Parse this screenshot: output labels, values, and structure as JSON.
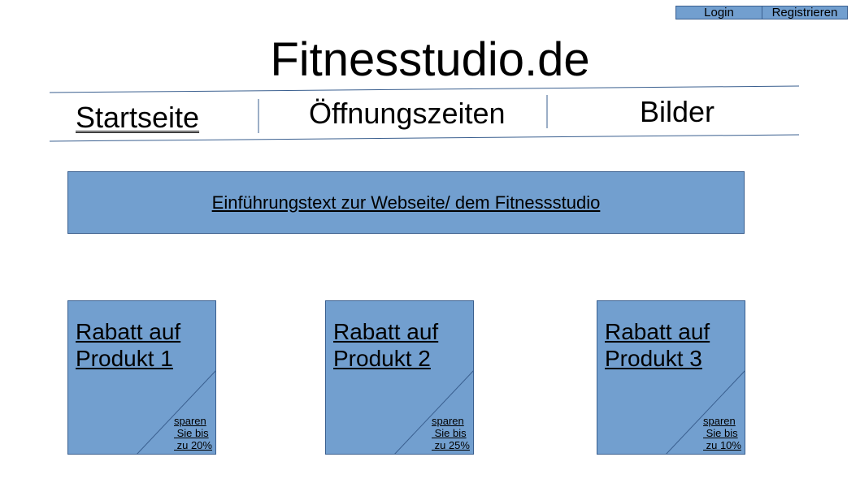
{
  "auth": {
    "login_label": "Login",
    "register_label": "Registrieren"
  },
  "site": {
    "title": "Fitnesstudio.de"
  },
  "nav": {
    "items": [
      {
        "label": "Startseite"
      },
      {
        "label": "Öffnungszeiten"
      },
      {
        "label": "Bilder"
      }
    ]
  },
  "intro": {
    "text": "Einführungstext zur Webseite/ dem Fitnessstudio"
  },
  "products": [
    {
      "title": "Rabatt auf Produkt 1",
      "note": "sparen\n Sie bis\n zu 20%"
    },
    {
      "title": "Rabatt auf Produkt 2",
      "note": "sparen\n Sie bis\n zu 25%"
    },
    {
      "title": "Rabatt auf Produkt 3",
      "note": "sparen\n Sie bis\n zu 10%"
    }
  ],
  "colors": {
    "accent": "#729fcf",
    "border": "#3a5f8f"
  }
}
